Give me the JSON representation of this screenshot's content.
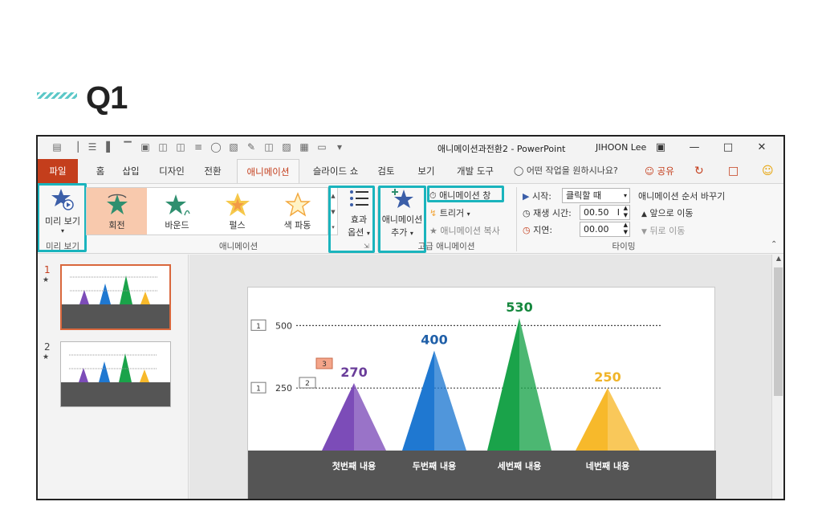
{
  "heading": "Q1",
  "window": {
    "title": "애니메이션과전환2  -  PowerPoint",
    "user": "JIHOON Lee",
    "controls": [
      "ribbon-display",
      "minimize",
      "maximize",
      "close"
    ]
  },
  "tabs": {
    "file": "파일",
    "items": [
      "홈",
      "삽입",
      "디자인",
      "전환",
      "애니메이션",
      "슬라이드 쇼",
      "검토",
      "보기",
      "개발 도구"
    ],
    "active": "애니메이션",
    "tell_me": "어떤 작업을 원하시나요?",
    "share": "공유"
  },
  "ribbon": {
    "preview": {
      "label_top": "미리 보기",
      "group": "미리 보기"
    },
    "animations": {
      "items": [
        "회전",
        "바운드",
        "펄스",
        "색 파동"
      ],
      "selected": "회전",
      "effect_options_1": "효과",
      "effect_options_2": "옵션",
      "group": "애니메이션"
    },
    "advanced": {
      "add_animation_1": "애니메이션",
      "add_animation_2": "추가",
      "pane": "애니메이션 창",
      "trigger": "트리거",
      "painter": "애니메이션 복사",
      "group": "고급 애니메이션"
    },
    "timing": {
      "start_label": "시작:",
      "start_value": "클릭할 때",
      "duration_label": "재생 시간:",
      "duration_value": "00.50",
      "delay_label": "지연:",
      "delay_value": "00.00",
      "reorder_title": "애니메이션 순서 바꾸기",
      "move_earlier": "앞으로 이동",
      "move_later": "뒤로 이동",
      "group": "타이밍"
    }
  },
  "slides": [
    {
      "number": "1",
      "selected": true
    },
    {
      "number": "2",
      "selected": false
    }
  ],
  "slide": {
    "gridlines": [
      {
        "value": "500",
        "tag": "1"
      },
      {
        "value": "250",
        "tag": "1"
      }
    ],
    "anim_tags": [
      "3",
      "2"
    ],
    "categories": [
      "첫번째 내용",
      "두번째 내용",
      "세번째 내용",
      "네번째 내용"
    ],
    "values": [
      270,
      400,
      530,
      250
    ],
    "value_labels": [
      "270",
      "400",
      "530",
      "250"
    ],
    "colors": [
      "#7c4cb8",
      "#1f78d1",
      "#1aa34a",
      "#f7b92b"
    ],
    "label_colors": [
      "#6a3d9a",
      "#1f5fa8",
      "#15873d",
      "#f0b429"
    ],
    "ylim": [
      0,
      530
    ],
    "band_color": "#555555"
  },
  "colors": {
    "accent": "#c43e1c",
    "highlight": "#1ab4bd"
  }
}
